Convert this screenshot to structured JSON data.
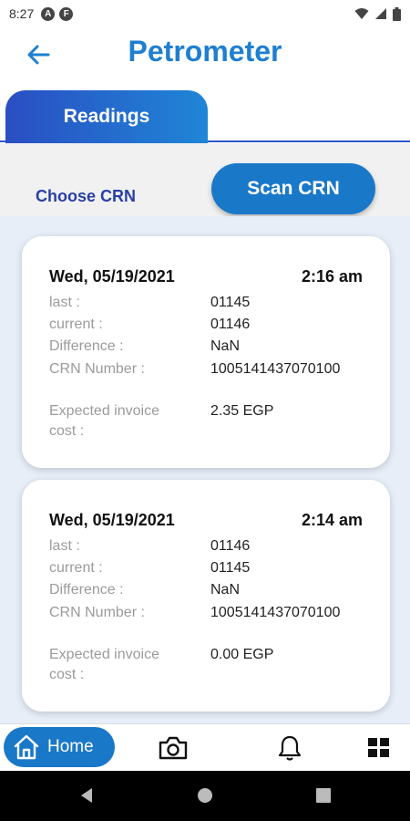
{
  "status_bar": {
    "time": "8:27",
    "icon_a": "A",
    "icon_b": "F"
  },
  "header": {
    "title": "Petrometer",
    "back_icon": "arrow-left-icon"
  },
  "tabs": [
    {
      "label": "Readings",
      "active": true
    }
  ],
  "actions": {
    "choose_label": "Choose CRN",
    "scan_label": "Scan CRN"
  },
  "labels": {
    "last": "last :",
    "current": "current :",
    "difference": "Difference :",
    "crn": "CRN Number :",
    "expected_1": "Expected invoice",
    "expected_2": "cost :"
  },
  "readings": [
    {
      "date": "Wed, 05/19/2021",
      "time": "2:16 am",
      "last": "01145",
      "current": "01146",
      "difference": "NaN",
      "crn": "1005141437070100",
      "cost": "2.35 EGP"
    },
    {
      "date": "Wed, 05/19/2021",
      "time": "2:14 am",
      "last": "01146",
      "current": "01145",
      "difference": "NaN",
      "crn": "1005141437070100",
      "cost": "0.00 EGP"
    }
  ],
  "bottom_nav": {
    "home_label": "Home",
    "icons": [
      "home-icon",
      "camera-icon",
      "bell-icon",
      "grid-icon"
    ]
  },
  "colors": {
    "primary": "#1a78c9",
    "title_blue": "#1e7fd0",
    "tab_gradient_start": "#2a4ec3",
    "link_blue": "#2a3fa6"
  }
}
